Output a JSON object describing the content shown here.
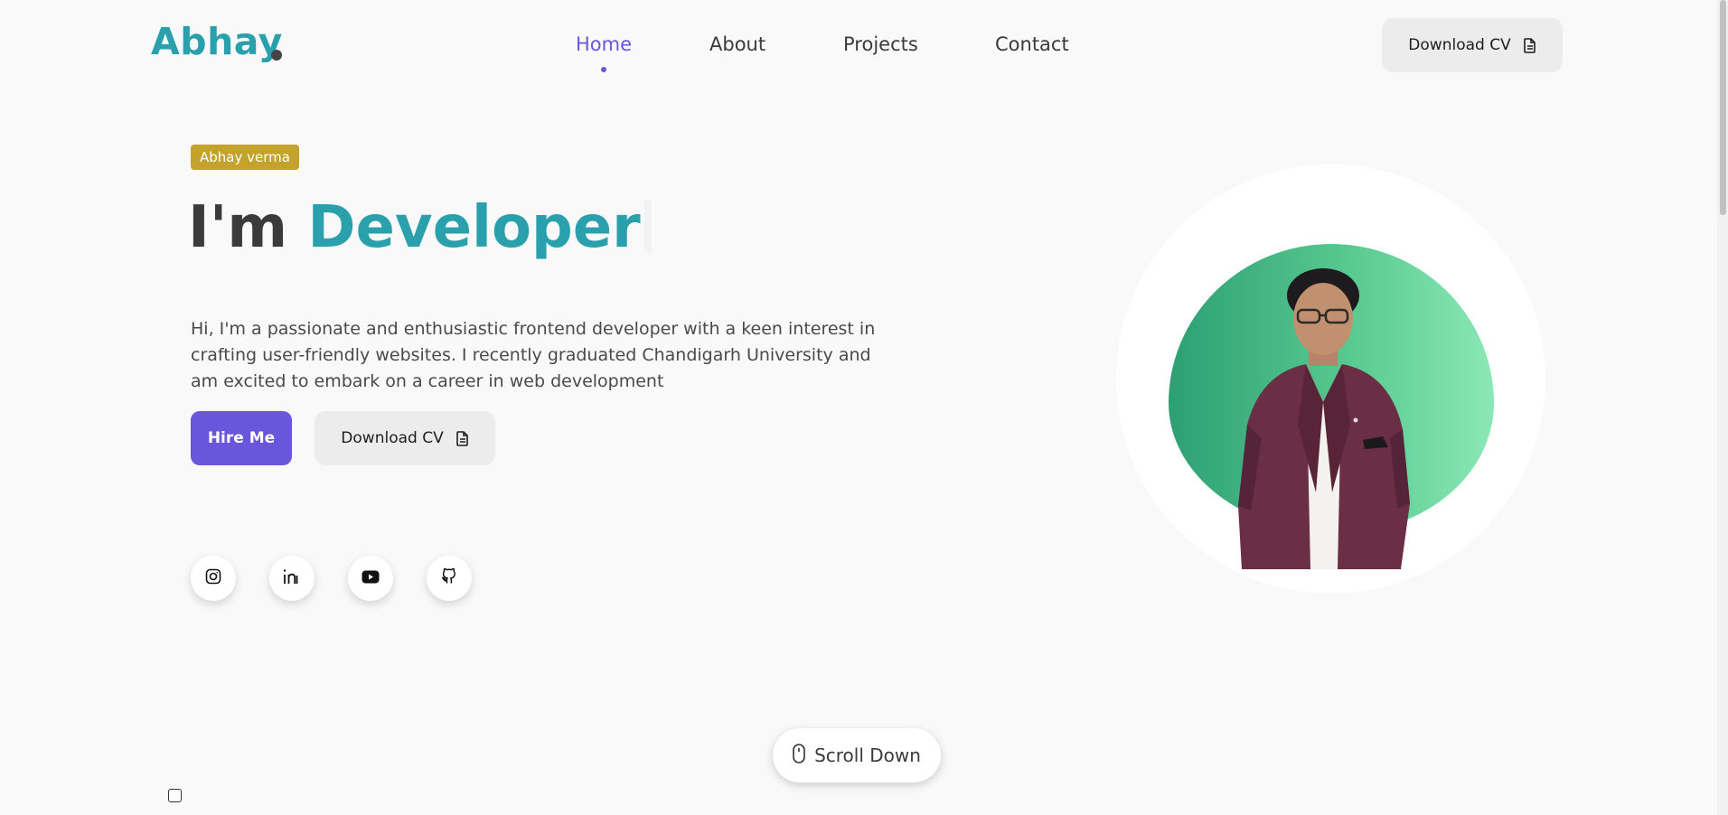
{
  "header": {
    "logo": "Abhay",
    "nav": [
      {
        "label": "Home",
        "active": true
      },
      {
        "label": "About",
        "active": false
      },
      {
        "label": "Projects",
        "active": false
      },
      {
        "label": "Contact",
        "active": false
      }
    ],
    "cv_button": "Download CV"
  },
  "hero": {
    "tag": "Abhay verma",
    "headline_prefix": "I'm",
    "headline_accent": "Developer",
    "bio": "Hi, I'm a passionate and enthusiastic frontend developer with a keen interest in crafting user-friendly websites. I recently graduated Chandigarh University and am excited to embark on a career in web development",
    "hire_button": "Hire Me",
    "cv_button": "Download CV",
    "socials": [
      "instagram-icon",
      "linkedin-icon",
      "youtube-icon",
      "github-icon"
    ]
  },
  "scroll": {
    "label": "Scroll Down"
  },
  "colors": {
    "brand_teal": "#2aa0ac",
    "accent_purple": "#6a55dd",
    "tag_gold": "#c4a32d",
    "background": "#f9f9f9"
  }
}
